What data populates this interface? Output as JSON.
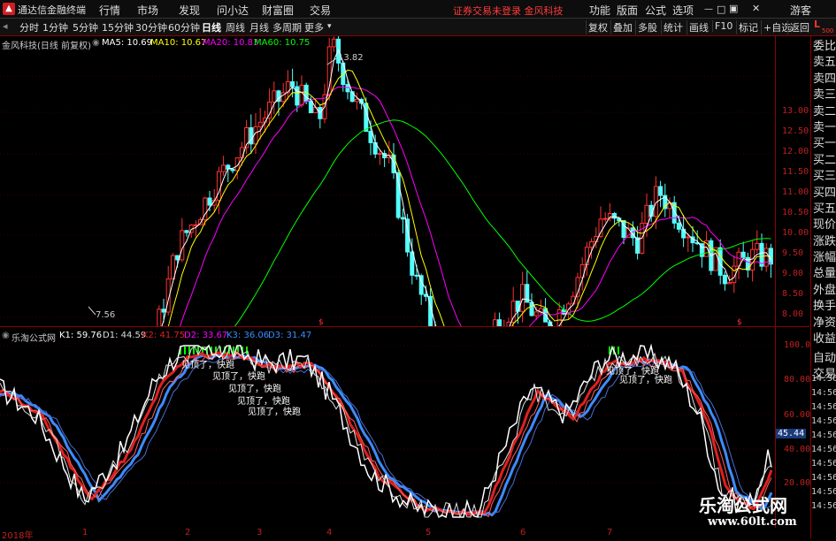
{
  "titlebar": {
    "app_title": "通达信金融终端",
    "menus": [
      "行情",
      "市场",
      "发现",
      "问小达",
      "财富圈",
      "交易"
    ],
    "notice": "证券交易未登录  金风科技",
    "right_menus": [
      "功能",
      "版面",
      "公式",
      "选项"
    ],
    "user": "游客"
  },
  "toolbar": {
    "periods": [
      "分时",
      "1分钟",
      "5分钟",
      "15分钟",
      "30分钟",
      "60分钟",
      "日线",
      "周线",
      "月线",
      "多周期",
      "更多"
    ],
    "active_period": "日线",
    "right_buttons": [
      "复权",
      "叠加",
      "多股",
      "统计",
      "画线",
      "F10",
      "标记",
      "+自选",
      "返回"
    ]
  },
  "main_legend": {
    "stock": "金风科技(日线 前复权)",
    "ma5": "MA5: 10.69",
    "ma10": "MA10: 10.67",
    "ma20": "MA20: 10.83",
    "ma60": "MA60: 10.75"
  },
  "main_annotations": {
    "high": "13.82",
    "low": "7.56"
  },
  "main_yaxis": [
    "13.00",
    "12.50",
    "12.00",
    "11.50",
    "11.00",
    "10.50",
    "10.00",
    "9.50",
    "9.00",
    "8.50",
    "8.00"
  ],
  "corner_label": "L",
  "corner_sub": "500",
  "indicator_legend": {
    "name": "乐淘公式网",
    "k1": "K1: 59.76",
    "d1": "D1: 44.59",
    "k2": "K2: 41.75",
    "d2": "D2: 33.67",
    "k3": "K3: 36.06",
    "d3": "D3: 31.47"
  },
  "ind_yaxis": [
    "100.0",
    "80.00",
    "60.00",
    "40.00",
    "20.00"
  ],
  "ind_current": "45.44",
  "ind_annotation": "见顶了，快跑",
  "xaxis": [
    "2018年",
    "1",
    "2",
    "3",
    "4",
    "5",
    "6",
    "7"
  ],
  "sidebar_items": [
    "委比",
    "卖五",
    "卖四",
    "卖三",
    "卖二",
    "卖一",
    "买一",
    "买二",
    "买三",
    "买四",
    "买五",
    "现价",
    "涨跌",
    "涨幅",
    "总量",
    "外盘",
    "换手",
    "净资",
    "收益",
    "自动",
    "交易"
  ],
  "sidebar_times": [
    "14:56",
    "14:56",
    "14:56",
    "14:56",
    "14:56",
    "14:56",
    "14:56",
    "14:56",
    "14:56",
    "14:56"
  ],
  "watermark": {
    "brand": "乐淘公式网",
    "url": "www.60lt.com"
  },
  "colors": {
    "up": "#ff3232",
    "down": "#54ffff",
    "ma5": "#ffffff",
    "ma10": "#ffff00",
    "ma20": "#ff00ff",
    "ma60": "#00ff00",
    "axis": "#c02020"
  }
}
